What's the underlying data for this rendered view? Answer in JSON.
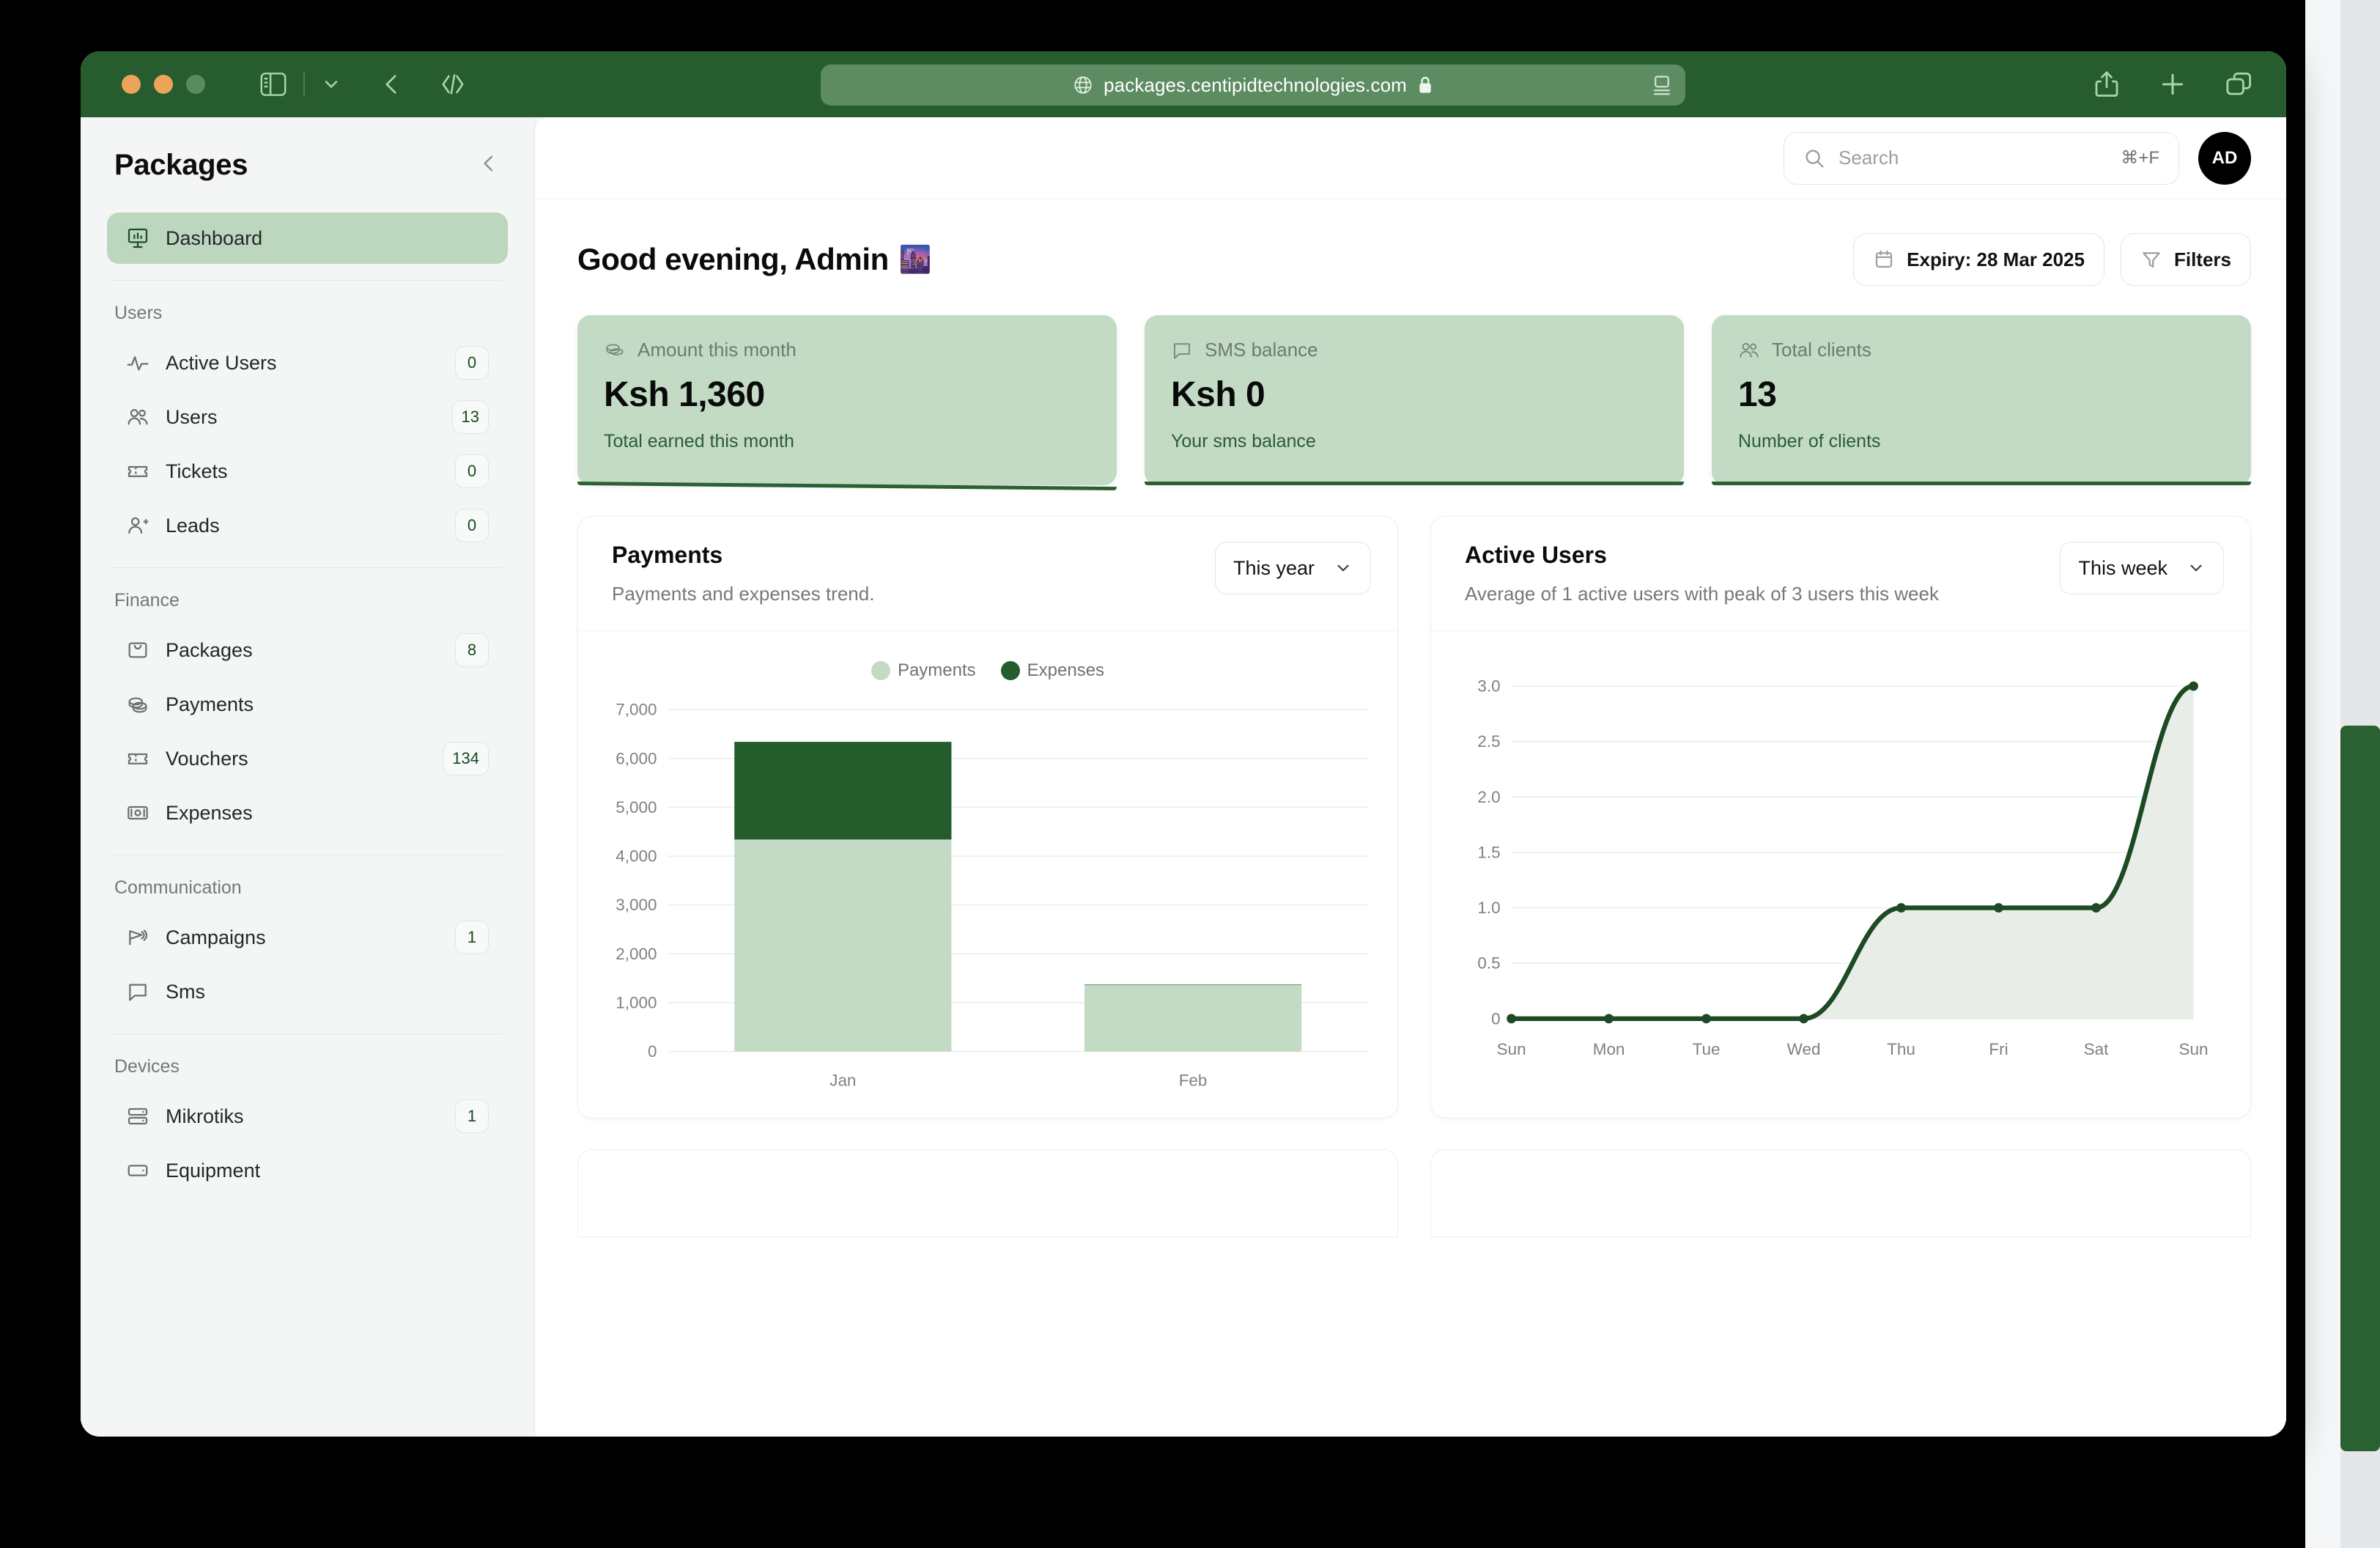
{
  "browser": {
    "url": "packages.centipidtechnologies.com",
    "icons": {
      "globe": "globe-icon",
      "lock": "lock-icon",
      "sidebar_toggle": "sidebar-toggle-icon",
      "chevron_down": "chevron-down-icon",
      "back": "back-chevron-icon",
      "dev_tools": "code-brackets-icon",
      "reader": "reader-view-icon",
      "share": "share-icon",
      "new_tab": "plus-icon",
      "tabs": "tab-overview-icon"
    }
  },
  "sidebar": {
    "title": "Packages",
    "collapse_icon": "chevron-left-icon",
    "primary": [
      {
        "label": "Dashboard",
        "icon": "presentation-chart-icon",
        "badge": null,
        "active": true
      }
    ],
    "sections": [
      {
        "title": "Users",
        "items": [
          {
            "label": "Active Users",
            "icon": "activity-pulse-icon",
            "badge": "0"
          },
          {
            "label": "Users",
            "icon": "users-icon",
            "badge": "13"
          },
          {
            "label": "Tickets",
            "icon": "ticket-icon",
            "badge": "0"
          },
          {
            "label": "Leads",
            "icon": "user-plus-icon",
            "badge": "0"
          }
        ]
      },
      {
        "title": "Finance",
        "items": [
          {
            "label": "Packages",
            "icon": "bag-icon",
            "badge": "8"
          },
          {
            "label": "Payments",
            "icon": "coins-icon",
            "badge": null
          },
          {
            "label": "Vouchers",
            "icon": "ticket-icon",
            "badge": "134"
          },
          {
            "label": "Expenses",
            "icon": "banknote-icon",
            "badge": null
          }
        ]
      },
      {
        "title": "Communication",
        "items": [
          {
            "label": "Campaigns",
            "icon": "megaphone-icon",
            "badge": "1"
          },
          {
            "label": "Sms",
            "icon": "chat-bubble-icon",
            "badge": null
          }
        ]
      },
      {
        "title": "Devices",
        "items": [
          {
            "label": "Mikrotiks",
            "icon": "server-icon",
            "badge": "1"
          },
          {
            "label": "Equipment",
            "icon": "device-card-icon",
            "badge": null
          }
        ]
      }
    ]
  },
  "topbar": {
    "search_placeholder": "Search",
    "search_value": "",
    "search_shortcut": "⌘+F",
    "search_icon": "search-icon",
    "avatar_initials": "AD"
  },
  "page": {
    "greeting": "Good evening, Admin",
    "greeting_emoji": "🌆",
    "expiry_button": "Expiry: 28 Mar 2025",
    "expiry_icon": "calendar-icon",
    "filters_button": "Filters",
    "filters_icon": "funnel-icon"
  },
  "stats": [
    {
      "label": "Amount this month",
      "icon": "coins-icon",
      "value": "Ksh 1,360",
      "sub": "Total earned this month"
    },
    {
      "label": "SMS balance",
      "icon": "chat-bubble-icon",
      "value": "Ksh 0",
      "sub": "Your sms balance"
    },
    {
      "label": "Total clients",
      "icon": "users-icon",
      "value": "13",
      "sub": "Number of clients"
    }
  ],
  "payments_panel": {
    "title": "Payments",
    "subtitle": "Payments and expenses trend.",
    "range_label": "This year",
    "range_icon": "chevron-down-icon"
  },
  "active_users_panel": {
    "title": "Active Users",
    "subtitle": "Average of 1 active users with peak of 3 users this week",
    "range_label": "This week",
    "range_icon": "chevron-down-icon"
  },
  "colors": {
    "brand_dark_green": "#265c2e",
    "payments_light": "#c3dbc5",
    "expenses_dark": "#245c2c",
    "card_green": "#c3dbc5",
    "sidebar_active": "#bdd7bf"
  },
  "chart_data": [
    {
      "type": "bar",
      "stacked": true,
      "title": "Payments",
      "subtitle": "Payments and expenses trend.",
      "categories": [
        "Jan",
        "Feb"
      ],
      "series": [
        {
          "name": "Payments",
          "values": [
            4340,
            1360
          ],
          "color": "#c3dbc5"
        },
        {
          "name": "Expenses",
          "values": [
            2000,
            10
          ],
          "color": "#245c2c"
        }
      ],
      "ylim": [
        0,
        7000
      ],
      "yticks": [
        0,
        1000,
        2000,
        3000,
        4000,
        5000,
        6000,
        7000
      ],
      "ytick_labels": [
        "0",
        "1,000",
        "2,000",
        "3,000",
        "4,000",
        "5,000",
        "6,000",
        "7,000"
      ],
      "xlabel": "",
      "ylabel": "",
      "grid": true,
      "legend_position": "top-center",
      "legend": [
        "Payments",
        "Expenses"
      ]
    },
    {
      "type": "area",
      "title": "Active Users",
      "subtitle": "Average of 1 active users with peak of 3 users this week",
      "x": [
        "Sun",
        "Mon",
        "Tue",
        "Wed",
        "Thu",
        "Fri",
        "Sat",
        "Sun"
      ],
      "series": [
        {
          "name": "Active Users",
          "values": [
            0,
            0,
            0,
            0,
            1,
            1,
            1,
            3
          ],
          "color": "#1c4a22"
        }
      ],
      "ylim": [
        0,
        3.0
      ],
      "yticks": [
        0,
        0.5,
        1.0,
        1.5,
        2.0,
        2.5,
        3.0
      ],
      "ytick_labels": [
        "0",
        "0.5",
        "1.0",
        "1.5",
        "2.0",
        "2.5",
        "3.0"
      ],
      "xlabel": "",
      "ylabel": "",
      "grid": true,
      "legend_position": "none",
      "markers": true
    }
  ]
}
